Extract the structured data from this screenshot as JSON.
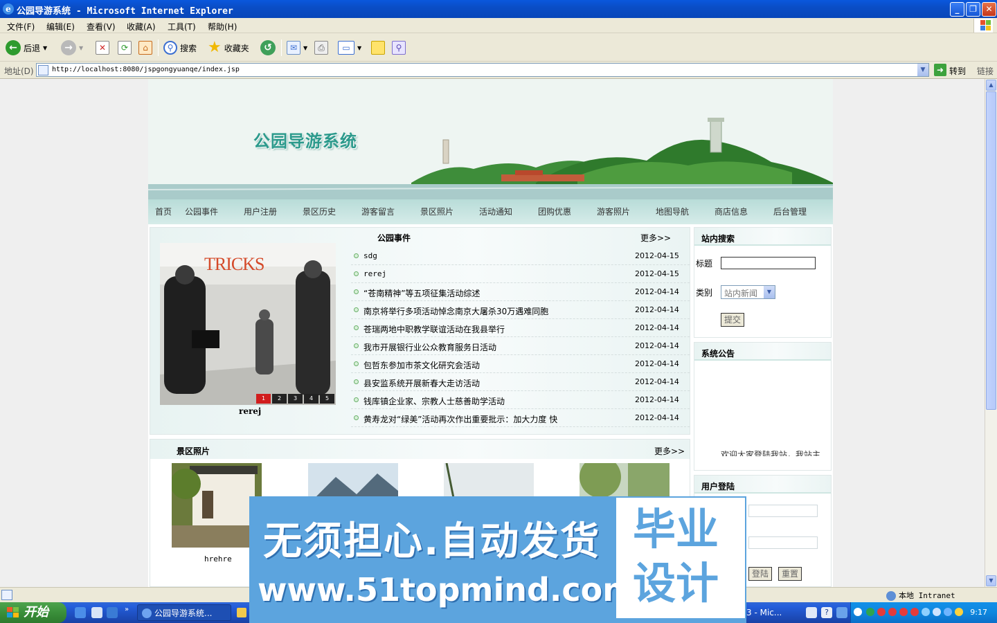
{
  "window": {
    "title": "公园导游系统 - Microsoft Internet Explorer"
  },
  "menu": [
    "文件(F)",
    "编辑(E)",
    "查看(V)",
    "收藏(A)",
    "工具(T)",
    "帮助(H)"
  ],
  "toolbar": {
    "back": "后退",
    "search": "搜索",
    "favorites": "收藏夹"
  },
  "address": {
    "label": "地址(D)",
    "url": "http://localhost:8080/jspgongyuanqe/index.jsp",
    "go": "转到",
    "links": "链接"
  },
  "site": {
    "title": "公园导游系统",
    "nav": [
      "首页",
      "公园事件",
      "用户注册",
      "景区历史",
      "游客留言",
      "景区照片",
      "活动通知",
      "团购优惠",
      "游客照片",
      "地图导航",
      "商店信息",
      "后台管理"
    ]
  },
  "slideshow": {
    "poster_title": "TRICKS",
    "pages": [
      "1",
      "2",
      "3",
      "4",
      "5"
    ],
    "active_page": 1,
    "caption": "rerej"
  },
  "news": {
    "title": "公园事件",
    "more": "更多>>",
    "items": [
      {
        "title": "sdg",
        "date": "2012-04-15"
      },
      {
        "title": "rerej",
        "date": "2012-04-15"
      },
      {
        "title": "“苍南精神”等五项征集活动综述",
        "date": "2012-04-14"
      },
      {
        "title": "南京将举行多项活动悼念南京大屠杀30万遇难同胞",
        "date": "2012-04-14"
      },
      {
        "title": "苍瑞两地中职教学联谊活动在我县举行",
        "date": "2012-04-14"
      },
      {
        "title": "我市开展银行业公众教育服务日活动",
        "date": "2012-04-14"
      },
      {
        "title": "包哲东参加市茶文化研究会活动",
        "date": "2012-04-14"
      },
      {
        "title": "县安监系统开展新春大走访活动",
        "date": "2012-04-14"
      },
      {
        "title": "钱库镇企业家、宗教人士慈善助学活动",
        "date": "2012-04-14"
      },
      {
        "title": "黄寿龙对“绿美”活动再次作出重要批示：加大力度 快",
        "date": "2012-04-14"
      }
    ]
  },
  "photos": {
    "title": "景区照片",
    "more": "更多>>",
    "items": [
      {
        "caption": "hrehre"
      },
      {
        "caption": ""
      },
      {
        "caption": ""
      },
      {
        "caption": ""
      }
    ]
  },
  "search_box": {
    "title": "站内搜索",
    "label_title": "标题",
    "label_type": "类别",
    "type_selected": "站内新闻",
    "submit": "提交"
  },
  "announcement": {
    "title": "系统公告",
    "text": "欢迎大家登陆我站，我站主"
  },
  "login": {
    "title": "用户登陆",
    "login": "登陆",
    "reset": "重置"
  },
  "statusbar": {
    "zone": "本地 Intranet"
  },
  "taskbar": {
    "start": "开始",
    "tasks": [
      "公园导游系统...",
      "3 - Mic..."
    ],
    "clock": "9:17"
  },
  "watermark": {
    "line1": "无须担心.自动发货",
    "url": "www.51topmind.com",
    "right1": "毕业",
    "right2": "设计"
  },
  "colors": {
    "title_teal": "#2c9a8c",
    "nav_bg": "#b8dcd8",
    "ad_blue": "#5ca4de",
    "pager_active": "#d11d1d"
  }
}
